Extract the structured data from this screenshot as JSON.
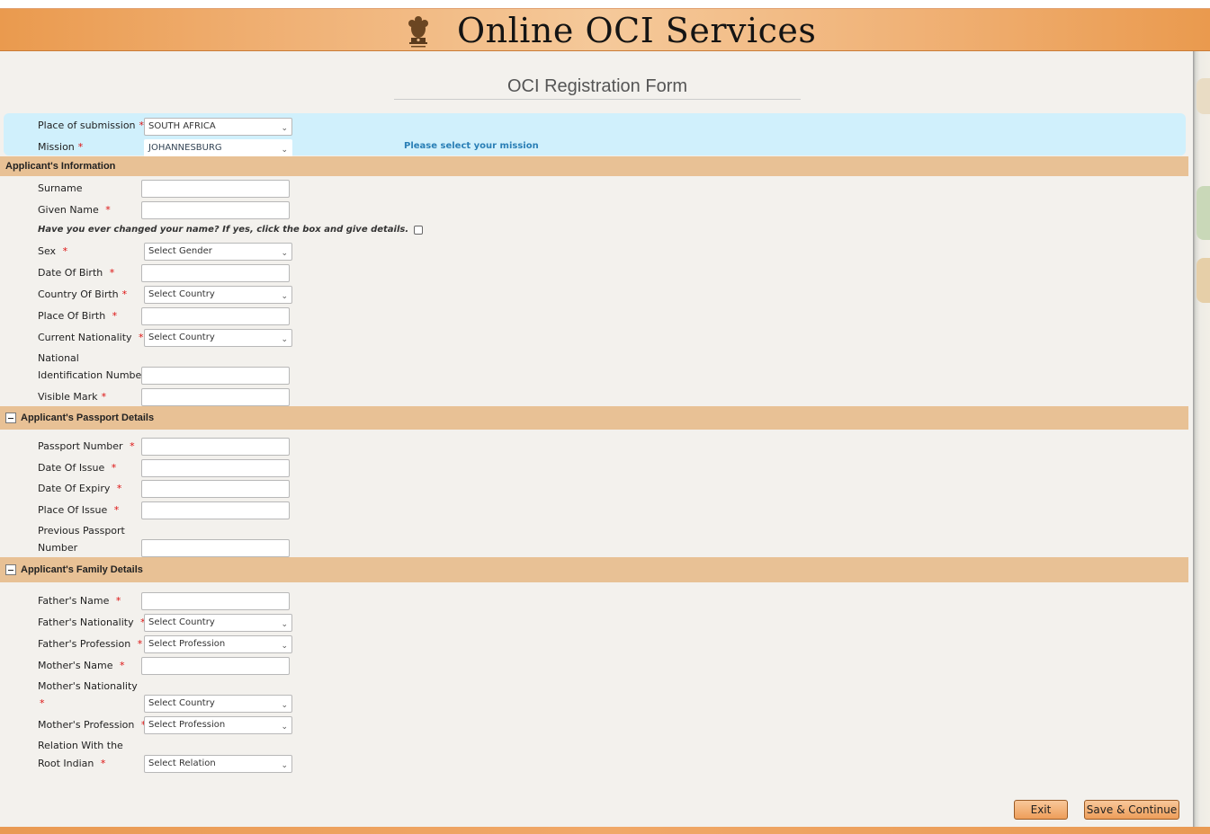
{
  "header": {
    "title": "Online OCI Services"
  },
  "form_title": "OCI Registration Form",
  "submission": {
    "place_label": "Place of submission",
    "place_value": "SOUTH AFRICA",
    "mission_label": "Mission",
    "mission_value": "JOHANNESBURG",
    "mission_note": "Please select your mission"
  },
  "applicant": {
    "section_title": "Applicant's Information",
    "surname_label": "Surname",
    "given_name_label": "Given Name",
    "name_change_text": "Have you ever changed your name? If yes, click the box and give details.",
    "sex_label": "Sex",
    "sex_value": "Select Gender",
    "dob_label": "Date Of Birth",
    "cob_label": "Country Of Birth",
    "cob_value": "Select Country",
    "pob_label": "Place Of Birth",
    "nationality_label": "Current Nationality",
    "nationality_value": "Select Country",
    "nid_label_1": "National",
    "nid_label_2": "Identification Number",
    "visible_mark_label": "Visible Mark"
  },
  "passport": {
    "section_title": "Applicant's Passport Details",
    "number_label": "Passport Number",
    "issue_date_label": "Date Of Issue",
    "expiry_label": "Date Of Expiry",
    "issue_place_label": "Place Of Issue",
    "prev_label_1": "Previous Passport",
    "prev_label_2": "Number"
  },
  "family": {
    "section_title": "Applicant's Family Details",
    "father_name_label": "Father's Name",
    "father_nat_label": "Father's Nationality",
    "father_nat_value": "Select Country",
    "father_prof_label": "Father's Profession",
    "father_prof_value": "Select Profession",
    "mother_name_label": "Mother's Name",
    "mother_nat_label": "Mother's Nationality",
    "mother_nat_value": "Select Country",
    "mother_prof_label": "Mother's Profession",
    "mother_prof_value": "Select Profession",
    "relation_label_1": "Relation With the",
    "relation_label_2": "Root Indian",
    "relation_value": "Select Relation"
  },
  "buttons": {
    "exit": "Exit",
    "save": "Save & Continue"
  },
  "icons": {
    "emblem": "state-emblem-icon",
    "collapse": "minus-square-icon",
    "dropdown": "chevron-down-icon"
  },
  "colors": {
    "header_orange": "#ea9a4e",
    "section_bar": "#e8c195",
    "mission_bg": "#d0f0fc",
    "note_blue": "#2a7fb6",
    "required_red": "#d11111"
  }
}
